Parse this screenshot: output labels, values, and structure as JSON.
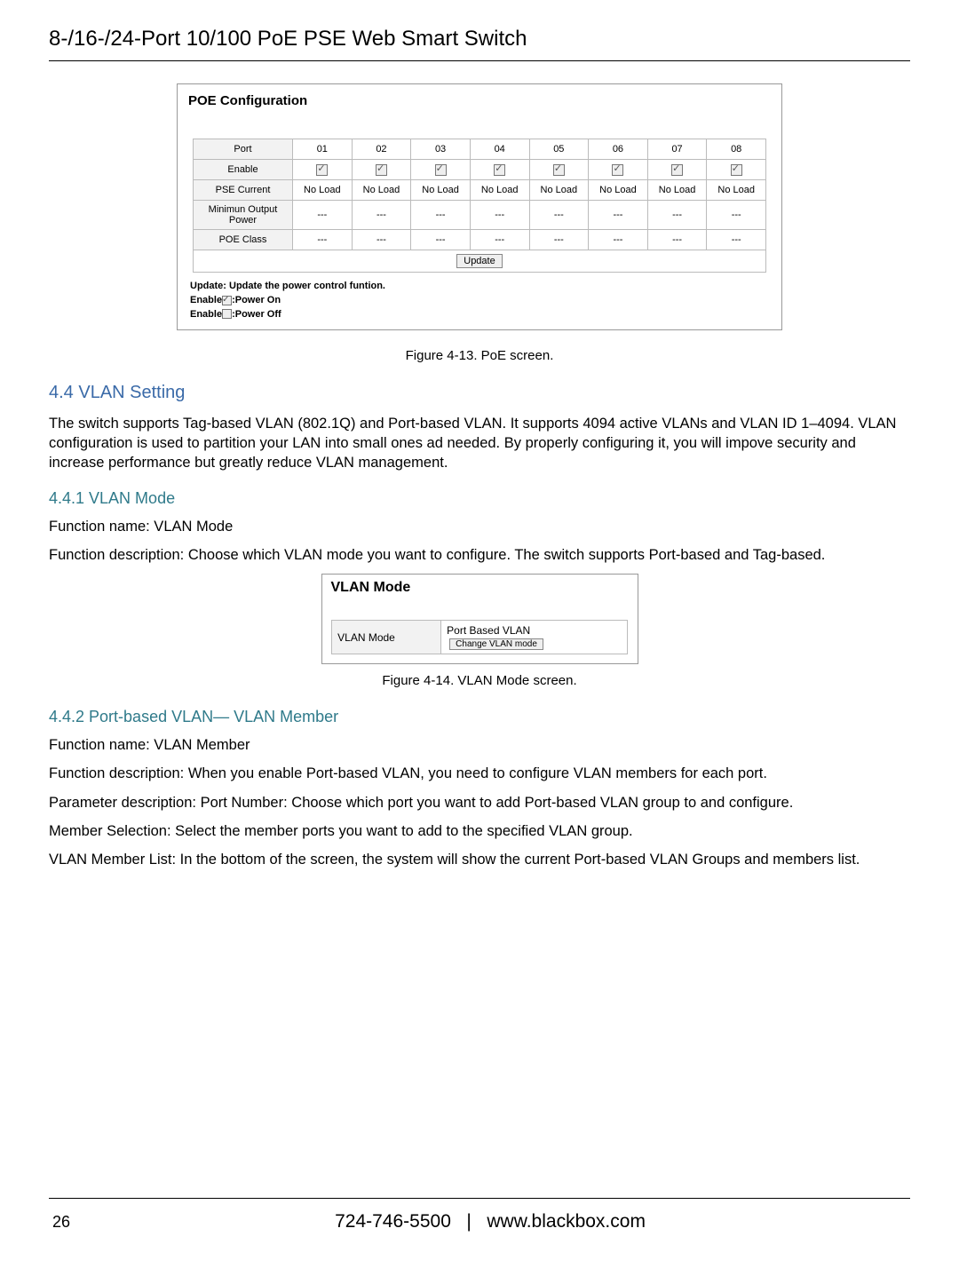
{
  "header": {
    "title": "8-/16-/24-Port 10/100 PoE PSE Web Smart Switch"
  },
  "poe": {
    "panel_title": "POE Configuration",
    "row_labels": {
      "port": "Port",
      "enable": "Enable",
      "pse_current": "PSE Current",
      "min_output": "Minimun Output Power",
      "poe_class": "POE Class"
    },
    "columns": [
      "01",
      "02",
      "03",
      "04",
      "05",
      "06",
      "07",
      "08"
    ],
    "enable": [
      true,
      true,
      true,
      true,
      true,
      true,
      true,
      true
    ],
    "pse_current": [
      "No Load",
      "No Load",
      "No Load",
      "No Load",
      "No Load",
      "No Load",
      "No Load",
      "No Load"
    ],
    "min_output": [
      "---",
      "---",
      "---",
      "---",
      "---",
      "---",
      "---",
      "---"
    ],
    "poe_class": [
      "---",
      "---",
      "---",
      "---",
      "---",
      "---",
      "---",
      "---"
    ],
    "update_btn": "Update",
    "notes_update": "Update: Update the power control funtion.",
    "notes_enable_on_prefix": "Enable",
    "notes_enable_on_suffix": ":Power On",
    "notes_enable_off_prefix": "Enable",
    "notes_enable_off_suffix": ":Power Off"
  },
  "captions": {
    "fig413": "Figure 4-13. PoE screen.",
    "fig414": "Figure 4-14. VLAN Mode screen."
  },
  "section44": {
    "heading": "4.4 VLAN Setting",
    "body": "The switch supports Tag-based VLAN (802.1Q) and Port-based VLAN. It supports 4094 active VLANs and VLAN ID 1–4094. VLAN configuration is used to partition your LAN into small ones ad needed. By properly configuring it, you will impove security and increase performance but greatly reduce VLAN management."
  },
  "section441": {
    "heading": "4.4.1 VLAN Mode",
    "fn_name": "Function name:  VLAN Mode",
    "fn_desc": "Function description: Choose which VLAN mode you want to configure. The switch supports Port-based and Tag-based."
  },
  "vlan_mode": {
    "panel_title": "VLAN Mode",
    "label": "VLAN Mode",
    "value": "Port Based VLAN",
    "btn": "Change VLAN mode"
  },
  "section442": {
    "heading": "4.4.2 Port-based VLAN— VLAN Member",
    "fn_name": "Function name:  VLAN Member",
    "fn_desc": "Function description: When you enable Port-based VLAN, you need to configure VLAN members for each port.",
    "param_desc": "Parameter description: Port Number: Choose which port you want to add Port-based VLAN group to and configure.",
    "member_sel": "Member Selection: Select the member ports you want to add to the specified VLAN group.",
    "vlan_list": "VLAN Member List: In the bottom of the screen, the system will show the current Port-based VLAN Groups and members list."
  },
  "footer": {
    "page_num": "26",
    "phone": "724-746-5500",
    "sep": "|",
    "url": "www.blackbox.com"
  }
}
